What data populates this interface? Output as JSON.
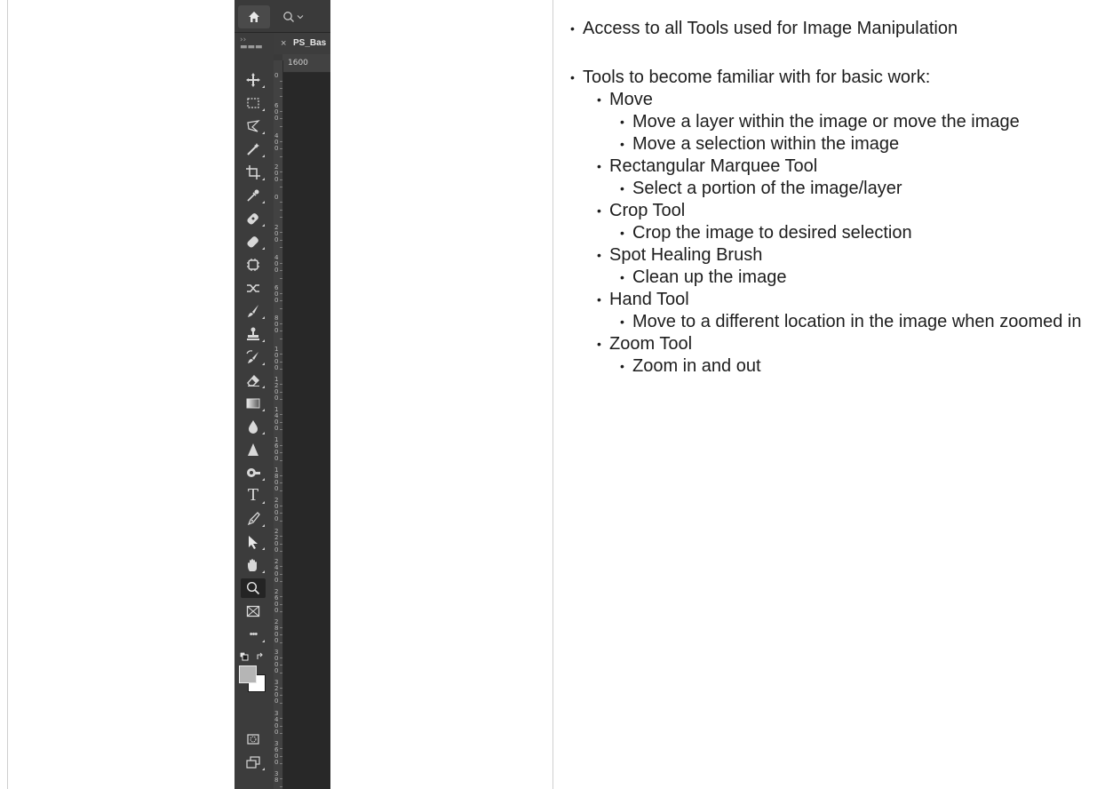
{
  "photoshop": {
    "tab_title": "PS_Bas",
    "ruler_h_value": "1600",
    "ruler_v_ticks": [
      "0",
      "6\n0\n0",
      "4\n0\n0",
      "2\n0\n0",
      "0",
      "2\n0\n0",
      "4\n0\n0",
      "6\n0\n0",
      "8\n0\n0",
      "1\n0\n0\n0",
      "1\n2\n0\n0",
      "1\n4\n0\n0",
      "1\n6\n0\n0",
      "1\n8\n0\n0",
      "2\n0\n0\n0",
      "2\n2\n0\n0",
      "2\n4\n0\n0",
      "2\n6\n0\n0",
      "2\n8\n0\n0",
      "3\n0\n0\n0",
      "3\n2\n0\n0",
      "3\n4\n0\n0",
      "3\n6\n0\n0",
      "3\n8"
    ],
    "tools": [
      {
        "name": "move-tool-icon"
      },
      {
        "name": "rectangular-marquee-tool-icon"
      },
      {
        "name": "lasso-tool-icon"
      },
      {
        "name": "magic-wand-tool-icon"
      },
      {
        "name": "crop-tool-icon"
      },
      {
        "name": "eyedropper-tool-icon"
      },
      {
        "name": "spot-healing-brush-icon"
      },
      {
        "name": "healing-bandage-icon"
      },
      {
        "name": "patch-tool-icon"
      },
      {
        "name": "content-aware-move-icon"
      },
      {
        "name": "brush-tool-icon"
      },
      {
        "name": "clone-stamp-tool-icon"
      },
      {
        "name": "history-brush-tool-icon"
      },
      {
        "name": "eraser-tool-icon"
      },
      {
        "name": "gradient-tool-icon"
      },
      {
        "name": "blur-tool-icon"
      },
      {
        "name": "sharpen-tool-icon"
      },
      {
        "name": "dodge-tool-icon"
      },
      {
        "name": "type-tool-icon"
      },
      {
        "name": "pen-tool-icon"
      },
      {
        "name": "path-selection-tool-icon"
      },
      {
        "name": "hand-tool-icon"
      },
      {
        "name": "zoom-tool-icon"
      },
      {
        "name": "frame-tool-icon"
      },
      {
        "name": "more-tools-icon"
      }
    ],
    "type_tool_glyph": "T",
    "more_tools_glyph": "•••"
  },
  "content": {
    "intro": "Access to all Tools used for Image Manipulation",
    "heading": "Tools to become familiar with for basic work:",
    "items": [
      {
        "label": "Move"
      },
      {
        "label": "Move a layer within the image or move the image"
      },
      {
        "label": "Move a selection within the image"
      },
      {
        "label": "Rectangular Marquee Tool"
      },
      {
        "label": "Select a portion of the image/layer"
      },
      {
        "label": "Crop Tool"
      },
      {
        "label": "Crop the image to desired selection"
      },
      {
        "label": "Spot Healing Brush"
      },
      {
        "label": "Clean up the image"
      },
      {
        "label": "Hand Tool"
      },
      {
        "label": "Move to a different location in the image when zoomed in"
      },
      {
        "label": "Zoom Tool"
      },
      {
        "label": "Zoom in and out"
      }
    ]
  }
}
